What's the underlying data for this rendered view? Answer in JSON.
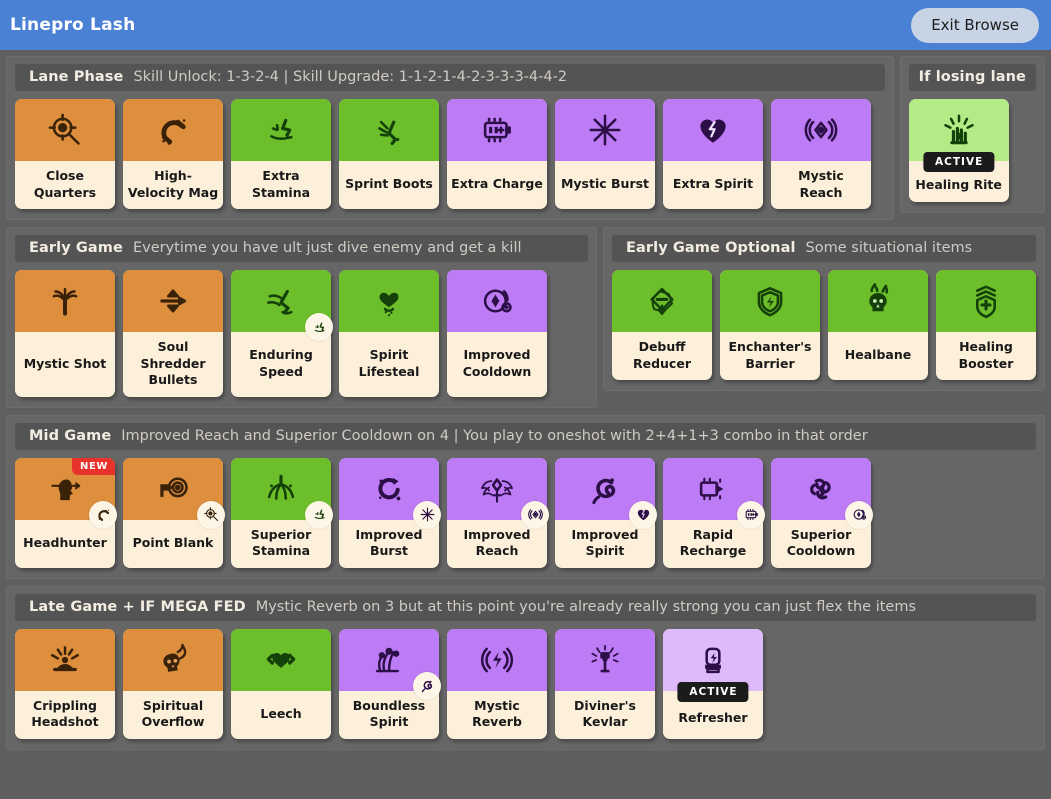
{
  "topbar": {
    "title": "Linepro Lash",
    "exit_label": "Exit Browse",
    "accent_color": "#4a81d4",
    "exit_button_color": "#c6d4e6"
  },
  "palette": {
    "page_background": "#5f5f5f",
    "panel_background": "#666666",
    "panel_header_background": "#545454",
    "card_body": "#fdf0da",
    "orange": "#dd8f3e",
    "green": "#6cbe2a",
    "purple": "#bd7bf5",
    "green_light": "#b5eb86",
    "purple_light": "#ddbbfa",
    "new_flag": "#e8322c",
    "active_tag": "#1b1b1b"
  },
  "sections": [
    {
      "id": "lane-phase",
      "title": "Lane Phase",
      "subtitle": "Skill Unlock: 1-3-2-4 | Skill Upgrade: 1-1-2-1-4-2-3-3-3-4-4-2",
      "items": [
        {
          "name": "Close Quarters",
          "tier": "orange",
          "icon": "scope-target-icon"
        },
        {
          "name": "High-Velocity Mag",
          "tier": "orange",
          "icon": "magnet-bullet-icon"
        },
        {
          "name": "Extra Stamina",
          "tier": "green",
          "icon": "boot-sparkle-icon"
        },
        {
          "name": "Sprint Boots",
          "tier": "green",
          "icon": "running-boot-icon"
        },
        {
          "name": "Extra Charge",
          "tier": "purple",
          "icon": "battery-plus-icon"
        },
        {
          "name": "Mystic Burst",
          "tier": "purple",
          "icon": "starburst-icon"
        },
        {
          "name": "Extra Spirit",
          "tier": "purple",
          "icon": "heart-bolt-icon"
        },
        {
          "name": "Mystic Reach",
          "tier": "purple",
          "icon": "radiating-diamond-icon"
        }
      ]
    },
    {
      "id": "if-losing-lane",
      "title": "If losing lane",
      "subtitle": "",
      "items": [
        {
          "name": "Healing Rite",
          "tier": "green-light",
          "icon": "healing-hand-icon",
          "active": "ACTIVE"
        }
      ]
    },
    {
      "id": "early-game",
      "title": "Early Game",
      "subtitle": "Everytime you have ult just dive enemy and get a kill",
      "items": [
        {
          "name": "Mystic Shot",
          "tier": "orange",
          "icon": "arrow-splash-icon"
        },
        {
          "name": "Soul Shredder Bullets",
          "tier": "orange",
          "icon": "double-arrow-bullet-icon"
        },
        {
          "name": "Enduring Speed",
          "tier": "green",
          "icon": "winged-boot-icon",
          "badge": "boot-sparkle-icon"
        },
        {
          "name": "Spirit Lifesteal",
          "tier": "green",
          "icon": "heart-hourglass-icon"
        },
        {
          "name": "Improved Cooldown",
          "tier": "purple",
          "icon": "cooldown-cycle-icon"
        }
      ]
    },
    {
      "id": "early-game-optional",
      "title": "Early Game Optional",
      "subtitle": "Some situational items",
      "items": [
        {
          "name": "Debuff Reducer",
          "tier": "green",
          "icon": "shield-minus-down-icon"
        },
        {
          "name": "Enchanter's Barrier",
          "tier": "green",
          "icon": "shield-bolt-icon"
        },
        {
          "name": "Healbane",
          "tier": "green",
          "icon": "burning-skull-icon"
        },
        {
          "name": "Healing Booster",
          "tier": "green",
          "icon": "shield-cross-up-icon"
        }
      ]
    },
    {
      "id": "mid-game",
      "title": "Mid Game",
      "subtitle": "Improved Reach and Superior Cooldown on 4 | You play to oneshot with 2+4+1+3 combo in that order",
      "items": [
        {
          "name": "Headhunter",
          "tier": "orange",
          "icon": "head-arrow-icon",
          "flag": "NEW",
          "badge": "magnet-bullet-icon"
        },
        {
          "name": "Point Blank",
          "tier": "orange",
          "icon": "gun-target-icon",
          "badge": "scope-target-icon"
        },
        {
          "name": "Superior Stamina",
          "tier": "green",
          "icon": "boot-stars-icon",
          "badge": "boot-sparkle-icon"
        },
        {
          "name": "Improved Burst",
          "tier": "purple",
          "icon": "swirl-burst-icon",
          "badge": "starburst-icon"
        },
        {
          "name": "Improved Reach",
          "tier": "purple",
          "icon": "winged-diamond-icon",
          "badge": "radiating-diamond-icon"
        },
        {
          "name": "Improved Spirit",
          "tier": "purple",
          "icon": "spiral-serpent-icon",
          "badge": "heart-bolt-icon"
        },
        {
          "name": "Rapid Recharge",
          "tier": "purple",
          "icon": "battery-arrow-icon",
          "badge": "battery-plus-icon"
        },
        {
          "name": "Superior Cooldown",
          "tier": "purple",
          "icon": "tangled-swirls-icon",
          "badge": "cooldown-cycle-icon"
        }
      ]
    },
    {
      "id": "late-game",
      "title": "Late Game + IF MEGA FED",
      "subtitle": "Mystic Reverb on 3 but at this point you're already really strong you can just flex the items",
      "items": [
        {
          "name": "Crippling Headshot",
          "tier": "orange",
          "icon": "meditating-figure-icon"
        },
        {
          "name": "Spiritual Overflow",
          "tier": "orange",
          "icon": "flaming-skull-icon"
        },
        {
          "name": "Leech",
          "tier": "green",
          "icon": "hands-heart-icon"
        },
        {
          "name": "Boundless Spirit",
          "tier": "purple",
          "icon": "ornate-spirit-icon",
          "badge": "spiral-serpent-icon"
        },
        {
          "name": "Mystic Reverb",
          "tier": "purple",
          "icon": "radiating-bolt-icon"
        },
        {
          "name": "Diviner's Kevlar",
          "tier": "purple",
          "icon": "radiant-lamp-icon"
        },
        {
          "name": "Refresher",
          "tier": "purple-light",
          "icon": "canister-bolt-icon",
          "active": "ACTIVE"
        }
      ]
    }
  ]
}
